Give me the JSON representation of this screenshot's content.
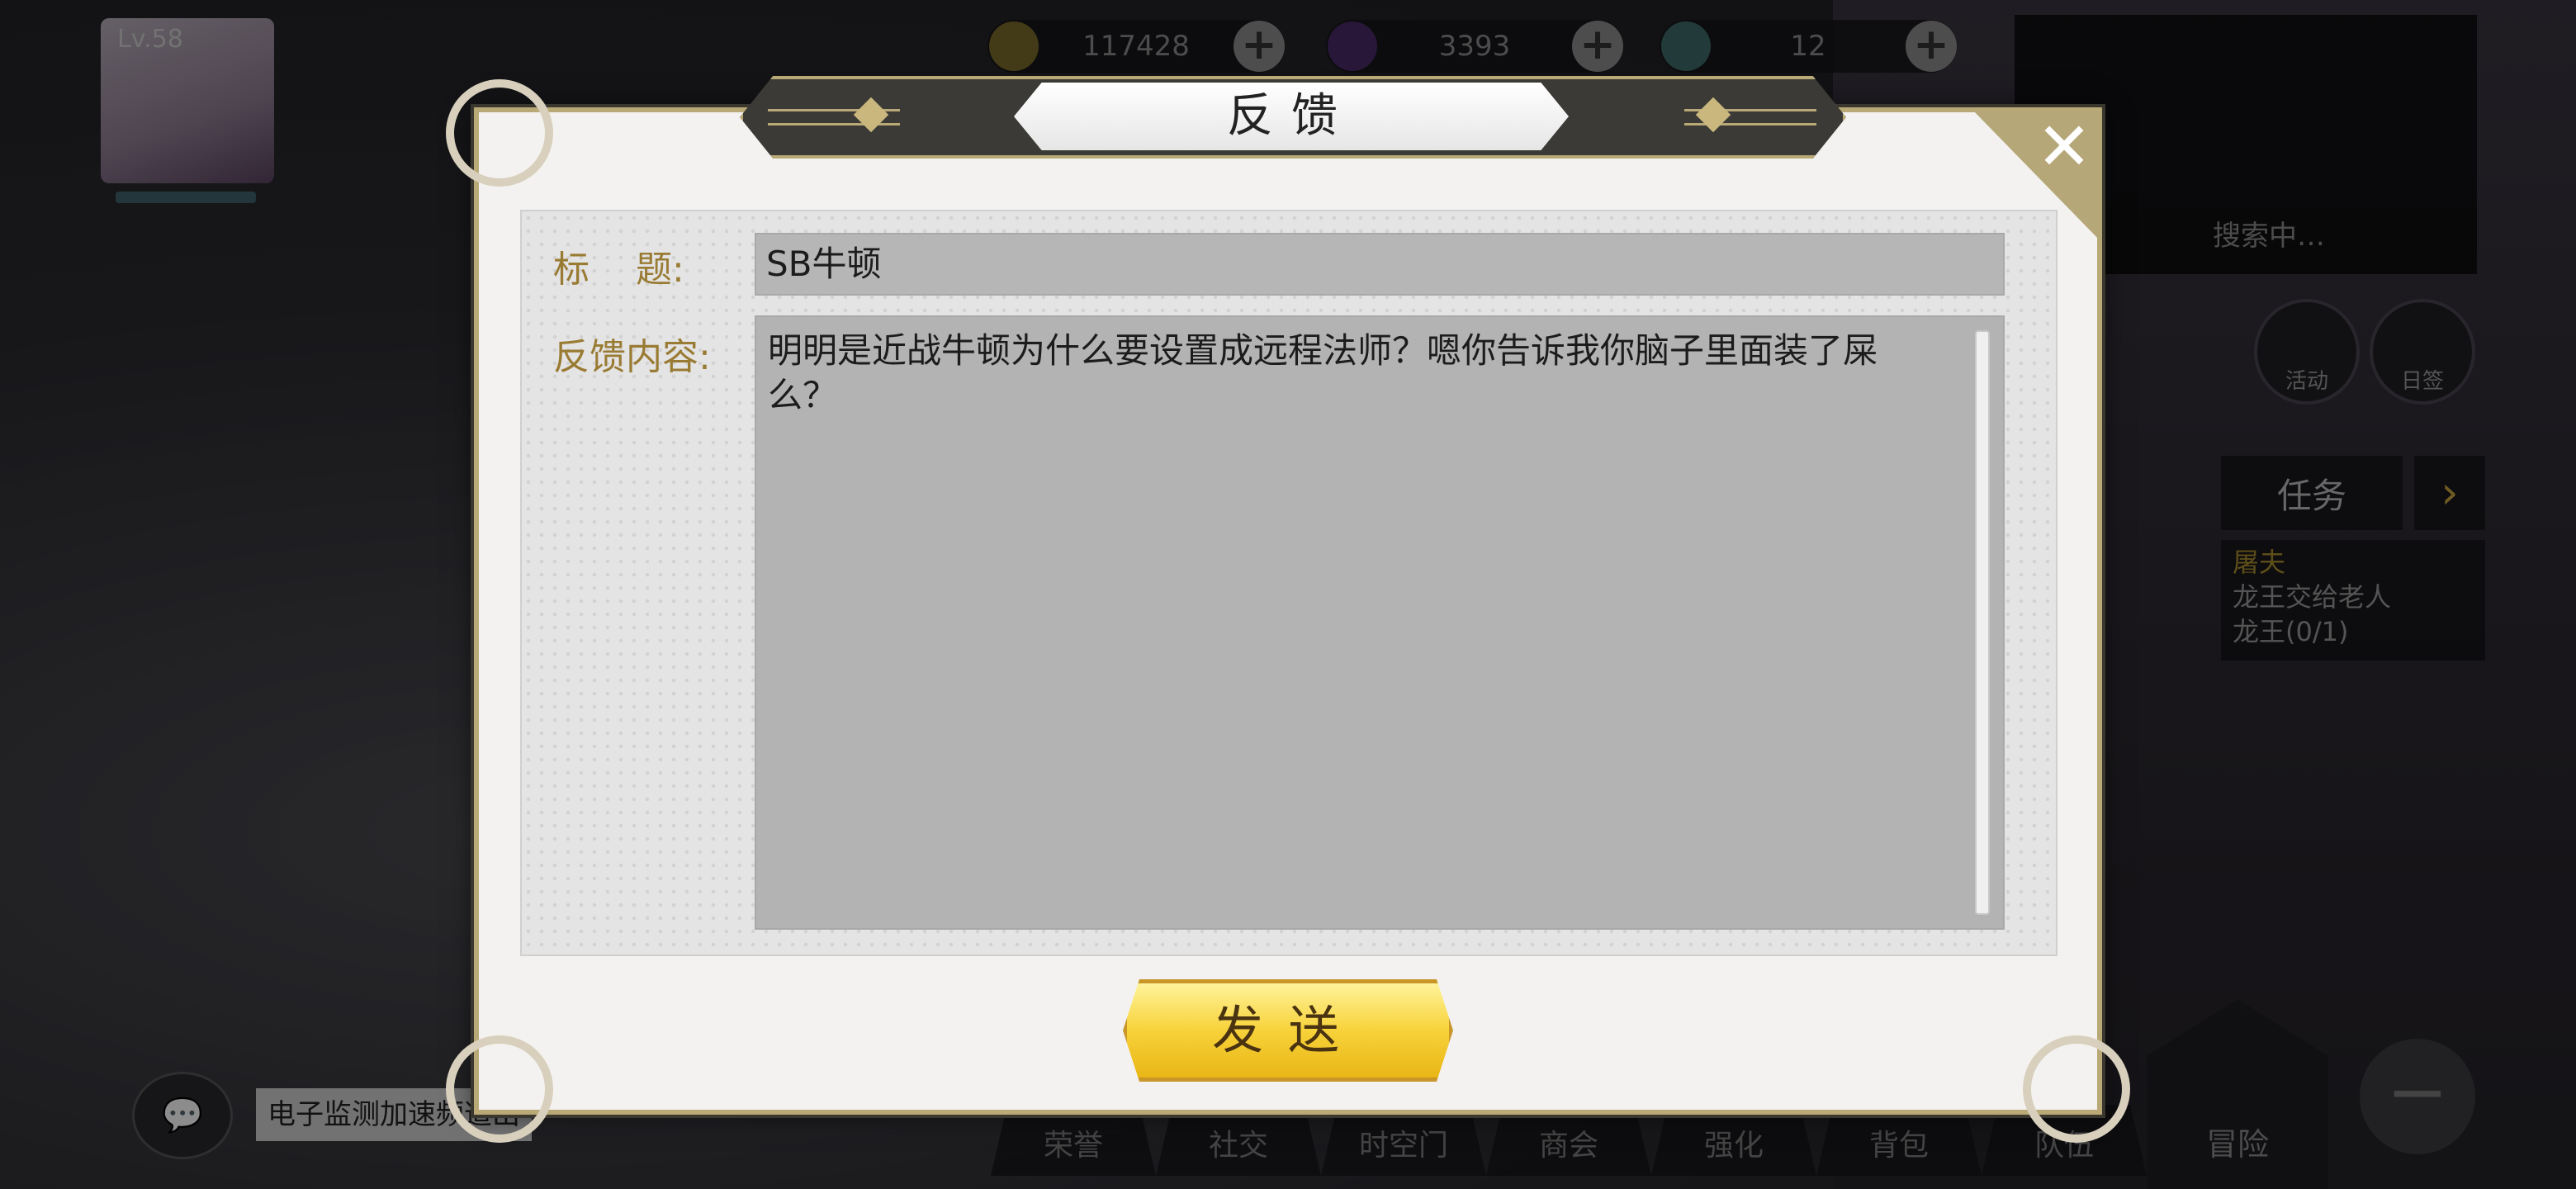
{
  "hud": {
    "level": "Lv.58",
    "currencies": [
      {
        "icon": "gold-coin-icon",
        "value": "117428"
      },
      {
        "icon": "purple-crystal-icon",
        "value": "3393"
      },
      {
        "icon": "rainbow-gem-icon",
        "value": "12"
      }
    ],
    "plus_symbol": "+",
    "minimap_status": "搜索中…"
  },
  "right_panel": {
    "activity_label": "活动",
    "diary_label": "日签",
    "task_label": "任务",
    "task_arrow": "›",
    "task_line1": "屠夫",
    "task_line2": "龙王交给老人",
    "task_line3": "龙王(0/1)"
  },
  "dialog": {
    "title": "反馈",
    "close_symbol": "✕",
    "title_label": "标    题:",
    "title_value": "SB牛顿",
    "content_label": "反馈内容:",
    "content_value": "明明是近战牛顿为什么要设置成远程法师？嗯你告诉我你脑子里面装了屎么？",
    "send_label": "发送"
  },
  "chat": {
    "bubble_symbol": "💬",
    "message": "电子监测加速频道出"
  },
  "bottom_nav": [
    "荣誉",
    "社交",
    "时空门",
    "商会",
    "强化",
    "背包",
    "队伍"
  ],
  "adventure_label": "冒险",
  "minus_symbol": "−",
  "colors": {
    "gold_border": "#b9a977",
    "label_gold": "#9a7b34",
    "send_yellow": "#f7d23a"
  }
}
